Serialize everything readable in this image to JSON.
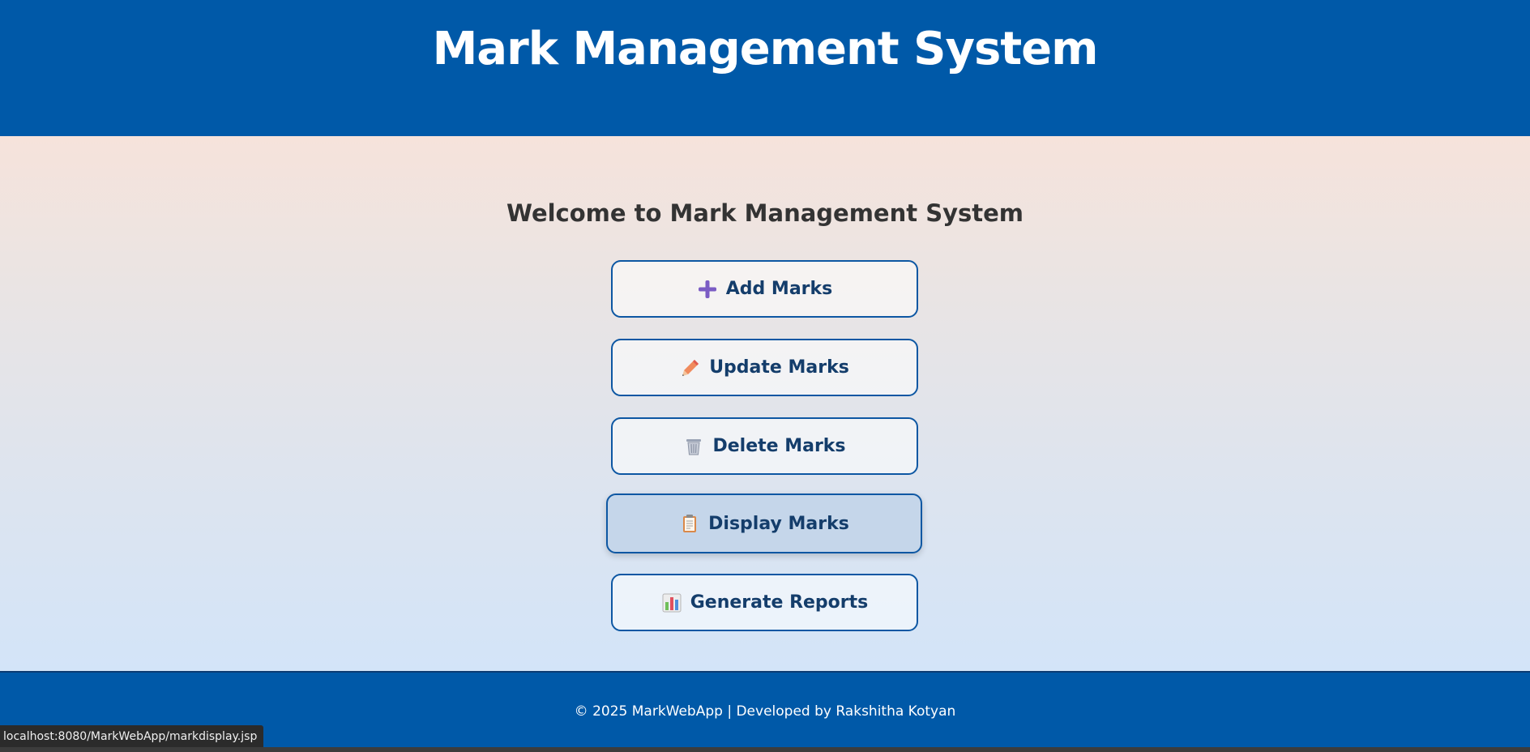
{
  "header": {
    "title": "Mark Management System"
  },
  "main": {
    "welcome": "Welcome to Mark Management System",
    "buttons": [
      {
        "label": "Add Marks",
        "icon": "plus-icon"
      },
      {
        "label": "Update Marks",
        "icon": "pencil-icon"
      },
      {
        "label": "Delete Marks",
        "icon": "trash-icon"
      },
      {
        "label": "Display Marks",
        "icon": "clipboard-icon",
        "hovered": true
      },
      {
        "label": "Generate Reports",
        "icon": "bar-chart-icon"
      }
    ]
  },
  "footer": {
    "text": "© 2025 MarkWebApp | Developed by Rakshitha Kotyan"
  },
  "status_bar": {
    "url": "localhost:8080/MarkWebApp/markdisplay.jsp"
  },
  "colors": {
    "header_bg": "#0059a8",
    "button_border": "#0d57a3",
    "button_text": "#143d6b",
    "hover_bg": "#c5d6ea"
  }
}
